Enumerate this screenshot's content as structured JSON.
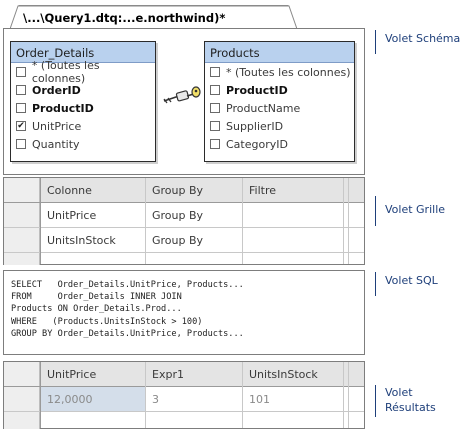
{
  "document_tab": {
    "title": "\\...\\Query1.dtq:...e.northwind)*"
  },
  "diagram": {
    "tables": [
      {
        "name": "Order_Details",
        "columns": [
          {
            "label": "* (Toutes les colonnes)",
            "checked": false,
            "bold": false
          },
          {
            "label": "OrderID",
            "checked": false,
            "bold": true
          },
          {
            "label": "ProductID",
            "checked": false,
            "bold": true
          },
          {
            "label": "UnitPrice",
            "checked": true,
            "bold": false
          },
          {
            "label": "Quantity",
            "checked": false,
            "bold": false
          }
        ]
      },
      {
        "name": "Products",
        "columns": [
          {
            "label": "* (Toutes les colonnes)",
            "checked": false,
            "bold": false
          },
          {
            "label": "ProductID",
            "checked": false,
            "bold": true
          },
          {
            "label": "ProductName",
            "checked": false,
            "bold": false
          },
          {
            "label": "SupplierID",
            "checked": false,
            "bold": false
          },
          {
            "label": "CategoryID",
            "checked": false,
            "bold": false
          }
        ]
      }
    ],
    "join_icon": "key-link-icon"
  },
  "grid": {
    "headers": [
      "Colonne",
      "Group By",
      "Filtre"
    ],
    "rows": [
      [
        "UnitPrice",
        "Group By",
        ""
      ],
      [
        "UnitsInStock",
        "Group By",
        ""
      ]
    ]
  },
  "sql": {
    "lines": [
      "SELECT   Order_Details.UnitPrice, Products...",
      "FROM     Order_Details INNER JOIN",
      "Products ON Order_Details.Prod...",
      "WHERE   (Products.UnitsInStock > 100)",
      "GROUP BY Order_Details.UnitPrice, Products..."
    ]
  },
  "results": {
    "headers": [
      "UnitPrice",
      "Expr1",
      "UnitsInStock"
    ],
    "rows": [
      [
        "12,0000",
        "3",
        "101"
      ]
    ]
  },
  "callouts": {
    "schema": "Volet Schéma",
    "grid": "Volet Grille",
    "sql": "Volet SQL",
    "results_line1": "Volet",
    "results_line2": "Résultats"
  },
  "colors": {
    "title_bar": "#b9d1ee",
    "callout": "#1e3f7a",
    "header": "#e4e4e4"
  }
}
